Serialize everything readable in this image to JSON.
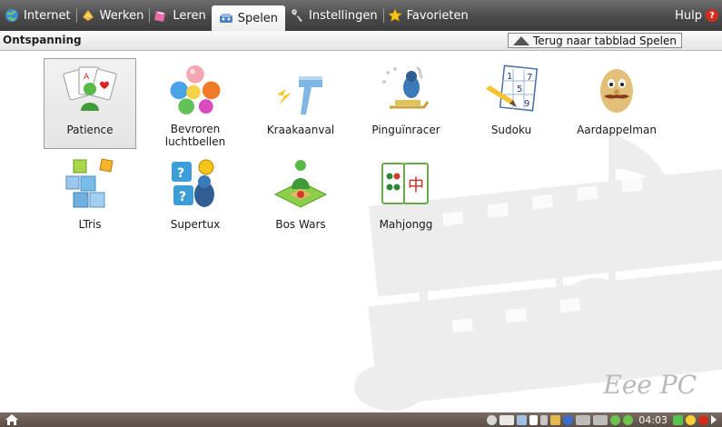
{
  "tabs": [
    {
      "label": "Internet",
      "icon": "globe-icon",
      "active": false
    },
    {
      "label": "Werken",
      "icon": "work-icon",
      "active": false
    },
    {
      "label": "Leren",
      "icon": "learn-icon",
      "active": false
    },
    {
      "label": "Spelen",
      "icon": "games-icon",
      "active": true
    },
    {
      "label": "Instellingen",
      "icon": "settings-icon",
      "active": false
    },
    {
      "label": "Favorieten",
      "icon": "star-icon",
      "active": false
    }
  ],
  "help_label": "Hulp",
  "help_icon_text": "?",
  "section_title": "Ontspanning",
  "back_button": "Terug naar tabblad Spelen",
  "apps": [
    {
      "label": "Patience",
      "icon": "patience-icon",
      "selected": true
    },
    {
      "label": "Bevroren luchtbellen",
      "icon": "bubbles-icon",
      "selected": false
    },
    {
      "label": "Kraakaanval",
      "icon": "hammer-icon",
      "selected": false
    },
    {
      "label": "Pinguïnracer",
      "icon": "penguin-sled-icon",
      "selected": false
    },
    {
      "label": "Sudoku",
      "icon": "sudoku-icon",
      "selected": false
    },
    {
      "label": "Aardappelman",
      "icon": "potato-icon",
      "selected": false
    },
    {
      "label": "LTris",
      "icon": "blocks-icon",
      "selected": false
    },
    {
      "label": "Supertux",
      "icon": "supertux-icon",
      "selected": false
    },
    {
      "label": "Bos Wars",
      "icon": "boswars-icon",
      "selected": false
    },
    {
      "label": "Mahjongg",
      "icon": "mahjongg-icon",
      "selected": false
    }
  ],
  "sudoku_digits": [
    "1",
    "7",
    "5",
    "9"
  ],
  "mahjongg_glyph": "中",
  "watermark_text": "Eee PC",
  "clock": "04:03",
  "colors": {
    "accent_red": "#d42a1c",
    "tab_bar": "#4a4a4a",
    "taskbar": "#5a4e46"
  }
}
